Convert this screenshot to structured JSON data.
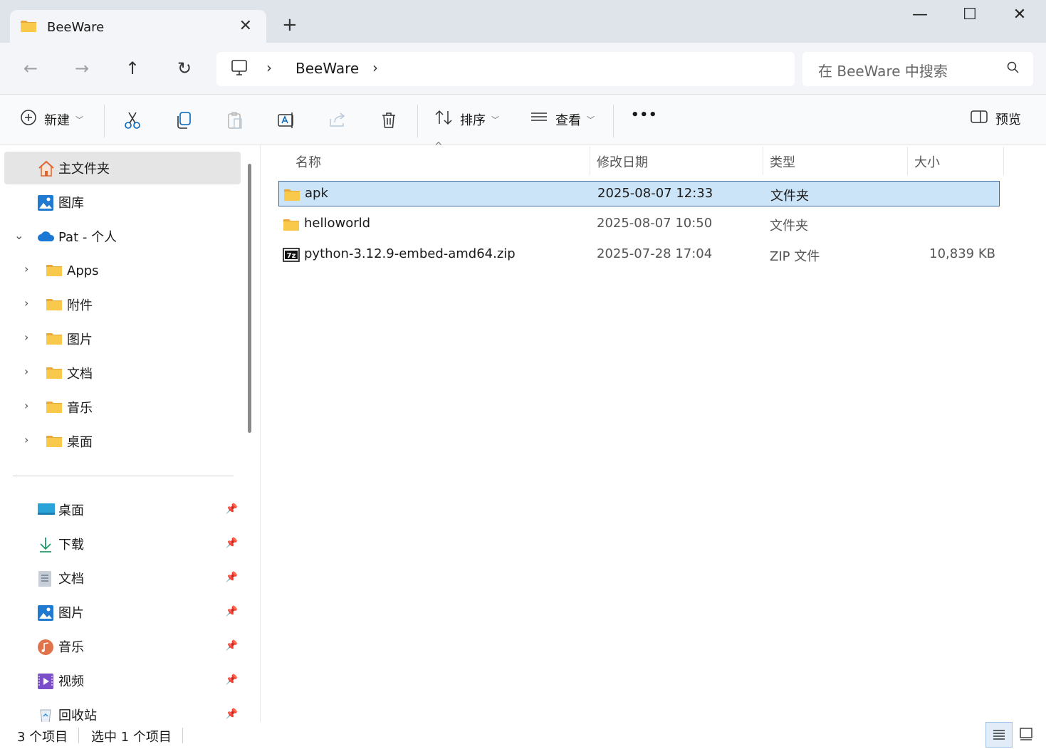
{
  "window": {
    "tab_title": "BeeWare",
    "minimize_glyph": "—",
    "maximize_glyph": "☐",
    "close_glyph": "✕",
    "new_tab_glyph": "+",
    "tab_close_glyph": "✕"
  },
  "nav": {
    "back_glyph": "←",
    "forward_glyph": "→",
    "up_glyph": "↑",
    "refresh_glyph": "↻",
    "breadcrumb_sep": "›",
    "breadcrumb": [
      "BeeWare"
    ],
    "search_placeholder": "在 BeeWare 中搜索"
  },
  "commands": {
    "new_label": "新建",
    "sort_label": "排序",
    "view_label": "查看",
    "more_label": "•••",
    "preview_label": "预览",
    "icons": [
      "cut-icon",
      "copy-icon",
      "paste-icon",
      "rename-icon",
      "share-icon",
      "delete-icon"
    ]
  },
  "sidebar": {
    "home": "主文件夹",
    "gallery": "图库",
    "onedrive": "Pat - 个人",
    "onedrive_children": [
      "Apps",
      "附件",
      "图片",
      "文档",
      "音乐",
      "桌面"
    ],
    "quick_access": [
      {
        "label": "桌面",
        "icon": "desktop-icon"
      },
      {
        "label": "下载",
        "icon": "download-icon"
      },
      {
        "label": "文档",
        "icon": "document-icon"
      },
      {
        "label": "图片",
        "icon": "pictures-icon"
      },
      {
        "label": "音乐",
        "icon": "music-icon"
      },
      {
        "label": "视频",
        "icon": "video-icon"
      },
      {
        "label": "回收站",
        "icon": "recycle-bin-icon"
      }
    ]
  },
  "columns": {
    "name": "名称",
    "modified": "修改日期",
    "type": "类型",
    "size": "大小"
  },
  "files": [
    {
      "name": "apk",
      "modified": "2025-08-07 12:33",
      "type": "文件夹",
      "size": "",
      "icon": "folder-icon",
      "selected": true
    },
    {
      "name": "helloworld",
      "modified": "2025-08-07 10:50",
      "type": "文件夹",
      "size": "",
      "icon": "folder-icon",
      "selected": false
    },
    {
      "name": "python-3.12.9-embed-amd64.zip",
      "modified": "2025-07-28 17:04",
      "type": "ZIP 文件",
      "size": "10,839 KB",
      "icon": "7zip-archive-icon",
      "selected": false
    }
  ],
  "status": {
    "item_count": "3 个项目",
    "selection": "选中 1 个项目"
  },
  "colors": {
    "accent": "#0067c0",
    "selection_bg": "#cce4f7",
    "folder_yellow": "#f8c94b"
  }
}
